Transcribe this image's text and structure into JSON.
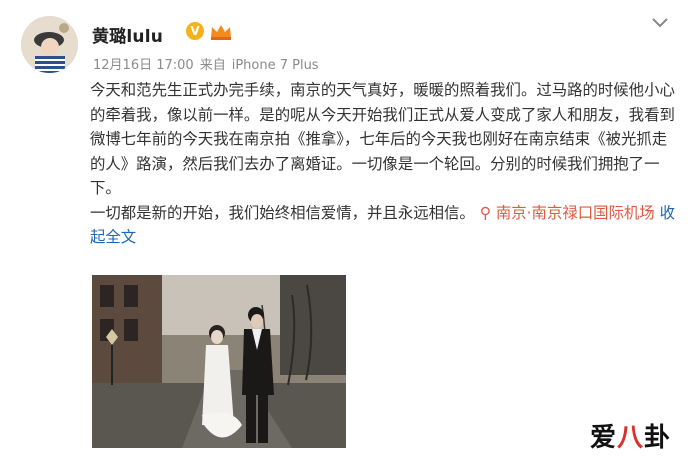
{
  "post": {
    "author": "黄璐lulu",
    "date": "12月16日 17:00",
    "source_prefix": "来自",
    "source": "iPhone 7 Plus",
    "paragraph1": "今天和范先生正式办完手续，南京的天气真好，暖暖的照着我们。过马路的时候他小心的牵着我，像以前一样。是的呢从今天开始我们正式从爱人变成了家人和朋友，我看到微博七年前的今天我在南京拍《推拿》，七年后的今天我也刚好在南京结束《被光抓走的人》路演，然后我们去办了离婚证。一切像是一个轮回。分别的时候我们拥抱了一下。",
    "paragraph2": "一切都是新的开始，我们始终相信爱情，并且永远相信。",
    "location": "南京·南京禄口国际机场",
    "collapse_label": "收起全文"
  },
  "colors": {
    "location": "#e05a43",
    "link": "#1e66b4",
    "meta": "#8b8b8b",
    "verified_badge": "#f5b21b"
  },
  "icons": {
    "verified": "verified-v-icon",
    "member": "crown-icon",
    "more": "chevron-down-icon",
    "location": "location-pin-icon"
  },
  "watermark": {
    "part1": "爱",
    "part2": "八",
    "part3": "卦"
  }
}
